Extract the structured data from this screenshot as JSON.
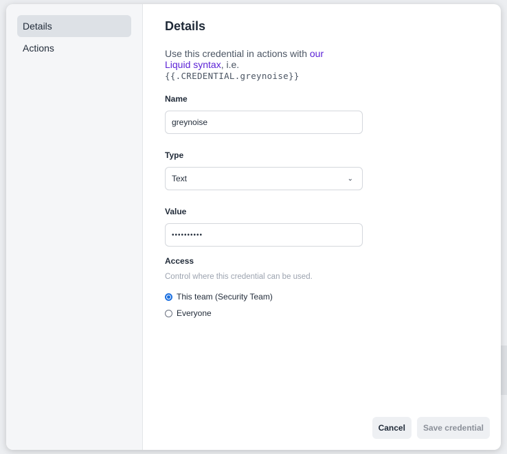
{
  "sidebar": {
    "items": [
      {
        "label": "Details"
      },
      {
        "label": "Actions"
      }
    ]
  },
  "main": {
    "title": "Details",
    "intro": {
      "prefix": "Use this credential in actions with ",
      "link": "our Liquid syntax",
      "suffix": ", i.e.",
      "code": "{{.CREDENTIAL.greynoise}}"
    },
    "name": {
      "label": "Name",
      "value": "greynoise"
    },
    "type": {
      "label": "Type",
      "value": "Text"
    },
    "value": {
      "label": "Value",
      "masked": "••••••••••"
    },
    "access": {
      "label": "Access",
      "help": "Control where this credential can be used.",
      "options": [
        {
          "label": "This team (Security Team)",
          "checked": true
        },
        {
          "label": "Everyone",
          "checked": false
        }
      ]
    }
  },
  "footer": {
    "cancel_label": "Cancel",
    "save_label": "Save credential"
  }
}
